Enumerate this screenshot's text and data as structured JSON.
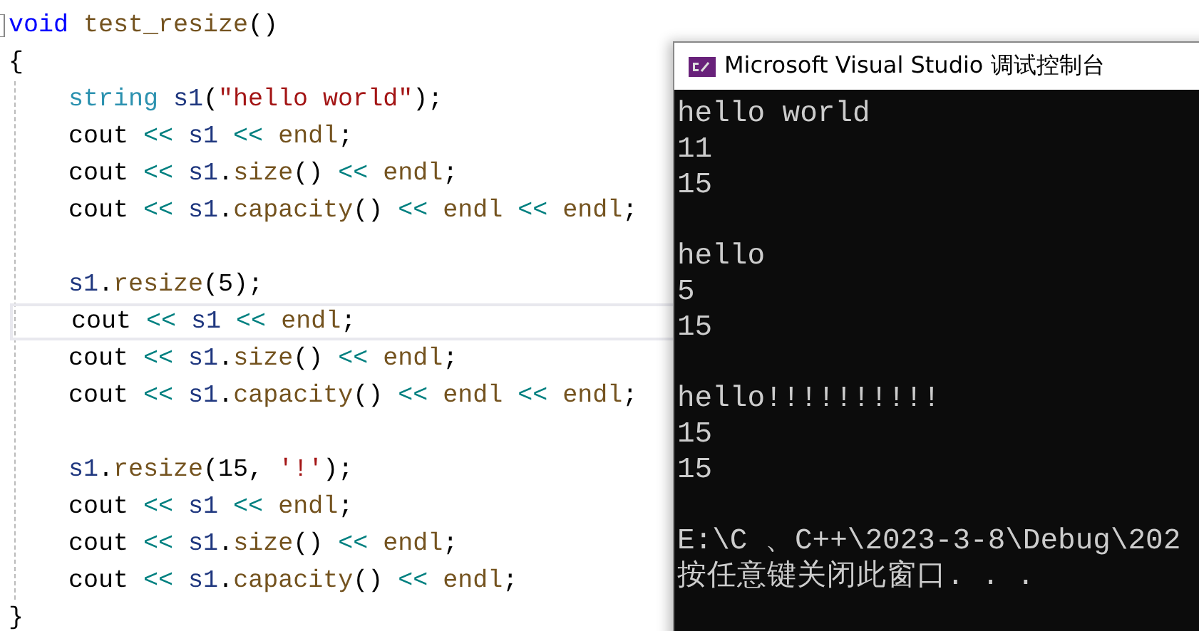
{
  "editor": {
    "signature": [
      {
        "kind": "keyword",
        "text": "void"
      },
      {
        "kind": "function",
        "text": " test_resize"
      },
      {
        "kind": "plain",
        "text": "()"
      }
    ],
    "open_brace": "{",
    "body": [
      {
        "kind": "code",
        "current": false,
        "tokens": [
          {
            "kind": "type",
            "text": "string"
          },
          {
            "kind": "variable",
            "text": " s1"
          },
          {
            "kind": "plain",
            "text": "("
          },
          {
            "kind": "string",
            "text": "\"hello world\""
          },
          {
            "kind": "plain",
            "text": ");"
          }
        ]
      },
      {
        "kind": "code",
        "current": false,
        "tokens": [
          {
            "kind": "plain",
            "text": "cout "
          },
          {
            "kind": "operator",
            "text": "<<"
          },
          {
            "kind": "variable",
            "text": " s1 "
          },
          {
            "kind": "operator",
            "text": "<<"
          },
          {
            "kind": "function",
            "text": " endl"
          },
          {
            "kind": "plain",
            "text": ";"
          }
        ]
      },
      {
        "kind": "code",
        "current": false,
        "tokens": [
          {
            "kind": "plain",
            "text": "cout "
          },
          {
            "kind": "operator",
            "text": "<<"
          },
          {
            "kind": "variable",
            "text": " s1"
          },
          {
            "kind": "plain",
            "text": "."
          },
          {
            "kind": "function",
            "text": "size"
          },
          {
            "kind": "plain",
            "text": "() "
          },
          {
            "kind": "operator",
            "text": "<<"
          },
          {
            "kind": "function",
            "text": " endl"
          },
          {
            "kind": "plain",
            "text": ";"
          }
        ]
      },
      {
        "kind": "code",
        "current": false,
        "tokens": [
          {
            "kind": "plain",
            "text": "cout "
          },
          {
            "kind": "operator",
            "text": "<<"
          },
          {
            "kind": "variable",
            "text": " s1"
          },
          {
            "kind": "plain",
            "text": "."
          },
          {
            "kind": "function",
            "text": "capacity"
          },
          {
            "kind": "plain",
            "text": "() "
          },
          {
            "kind": "operator",
            "text": "<<"
          },
          {
            "kind": "function",
            "text": " endl "
          },
          {
            "kind": "operator",
            "text": "<<"
          },
          {
            "kind": "function",
            "text": " endl"
          },
          {
            "kind": "plain",
            "text": ";"
          }
        ]
      },
      {
        "kind": "blank"
      },
      {
        "kind": "code",
        "current": false,
        "tokens": [
          {
            "kind": "variable",
            "text": "s1"
          },
          {
            "kind": "plain",
            "text": "."
          },
          {
            "kind": "function",
            "text": "resize"
          },
          {
            "kind": "plain",
            "text": "(5);"
          }
        ]
      },
      {
        "kind": "code",
        "current": true,
        "tokens": [
          {
            "kind": "plain",
            "text": "cout "
          },
          {
            "kind": "operator",
            "text": "<<"
          },
          {
            "kind": "variable",
            "text": " s1 "
          },
          {
            "kind": "operator",
            "text": "<<"
          },
          {
            "kind": "function",
            "text": " endl"
          },
          {
            "kind": "plain",
            "text": ";"
          }
        ]
      },
      {
        "kind": "code",
        "current": false,
        "tokens": [
          {
            "kind": "plain",
            "text": "cout "
          },
          {
            "kind": "operator",
            "text": "<<"
          },
          {
            "kind": "variable",
            "text": " s1"
          },
          {
            "kind": "plain",
            "text": "."
          },
          {
            "kind": "function",
            "text": "size"
          },
          {
            "kind": "plain",
            "text": "() "
          },
          {
            "kind": "operator",
            "text": "<<"
          },
          {
            "kind": "function",
            "text": " endl"
          },
          {
            "kind": "plain",
            "text": ";"
          }
        ]
      },
      {
        "kind": "code",
        "current": false,
        "tokens": [
          {
            "kind": "plain",
            "text": "cout "
          },
          {
            "kind": "operator",
            "text": "<<"
          },
          {
            "kind": "variable",
            "text": " s1"
          },
          {
            "kind": "plain",
            "text": "."
          },
          {
            "kind": "function",
            "text": "capacity"
          },
          {
            "kind": "plain",
            "text": "() "
          },
          {
            "kind": "operator",
            "text": "<<"
          },
          {
            "kind": "function",
            "text": " endl "
          },
          {
            "kind": "operator",
            "text": "<<"
          },
          {
            "kind": "function",
            "text": " endl"
          },
          {
            "kind": "plain",
            "text": ";"
          }
        ]
      },
      {
        "kind": "blank"
      },
      {
        "kind": "code",
        "current": false,
        "tokens": [
          {
            "kind": "variable",
            "text": "s1"
          },
          {
            "kind": "plain",
            "text": "."
          },
          {
            "kind": "function",
            "text": "resize"
          },
          {
            "kind": "plain",
            "text": "(15, "
          },
          {
            "kind": "string",
            "text": "'!'"
          },
          {
            "kind": "plain",
            "text": ");"
          }
        ]
      },
      {
        "kind": "code",
        "current": false,
        "tokens": [
          {
            "kind": "plain",
            "text": "cout "
          },
          {
            "kind": "operator",
            "text": "<<"
          },
          {
            "kind": "variable",
            "text": " s1 "
          },
          {
            "kind": "operator",
            "text": "<<"
          },
          {
            "kind": "function",
            "text": " endl"
          },
          {
            "kind": "plain",
            "text": ";"
          }
        ]
      },
      {
        "kind": "code",
        "current": false,
        "tokens": [
          {
            "kind": "plain",
            "text": "cout "
          },
          {
            "kind": "operator",
            "text": "<<"
          },
          {
            "kind": "variable",
            "text": " s1"
          },
          {
            "kind": "plain",
            "text": "."
          },
          {
            "kind": "function",
            "text": "size"
          },
          {
            "kind": "plain",
            "text": "() "
          },
          {
            "kind": "operator",
            "text": "<<"
          },
          {
            "kind": "function",
            "text": " endl"
          },
          {
            "kind": "plain",
            "text": ";"
          }
        ]
      },
      {
        "kind": "code",
        "current": false,
        "tokens": [
          {
            "kind": "plain",
            "text": "cout "
          },
          {
            "kind": "operator",
            "text": "<<"
          },
          {
            "kind": "variable",
            "text": " s1"
          },
          {
            "kind": "plain",
            "text": "."
          },
          {
            "kind": "function",
            "text": "capacity"
          },
          {
            "kind": "plain",
            "text": "() "
          },
          {
            "kind": "operator",
            "text": "<<"
          },
          {
            "kind": "function",
            "text": " endl"
          },
          {
            "kind": "plain",
            "text": ";"
          }
        ]
      }
    ],
    "close_brace": "}"
  },
  "console": {
    "title": "Microsoft Visual Studio 调试控制台",
    "lines": [
      {
        "kind": "text",
        "text": "hello world"
      },
      {
        "kind": "text",
        "text": "11"
      },
      {
        "kind": "text",
        "text": "15"
      },
      {
        "kind": "blank"
      },
      {
        "kind": "text",
        "text": "hello"
      },
      {
        "kind": "text",
        "text": "5"
      },
      {
        "kind": "text",
        "text": "15"
      },
      {
        "kind": "blank"
      },
      {
        "kind": "text",
        "text": "hello!!!!!!!!!!"
      },
      {
        "kind": "text",
        "text": "15"
      },
      {
        "kind": "text",
        "text": "15"
      },
      {
        "kind": "blank"
      },
      {
        "kind": "text",
        "text": "E:\\C 、C++\\2023-3-8\\Debug\\202"
      },
      {
        "kind": "text",
        "text": "按任意键关闭此窗口. . ."
      }
    ]
  }
}
